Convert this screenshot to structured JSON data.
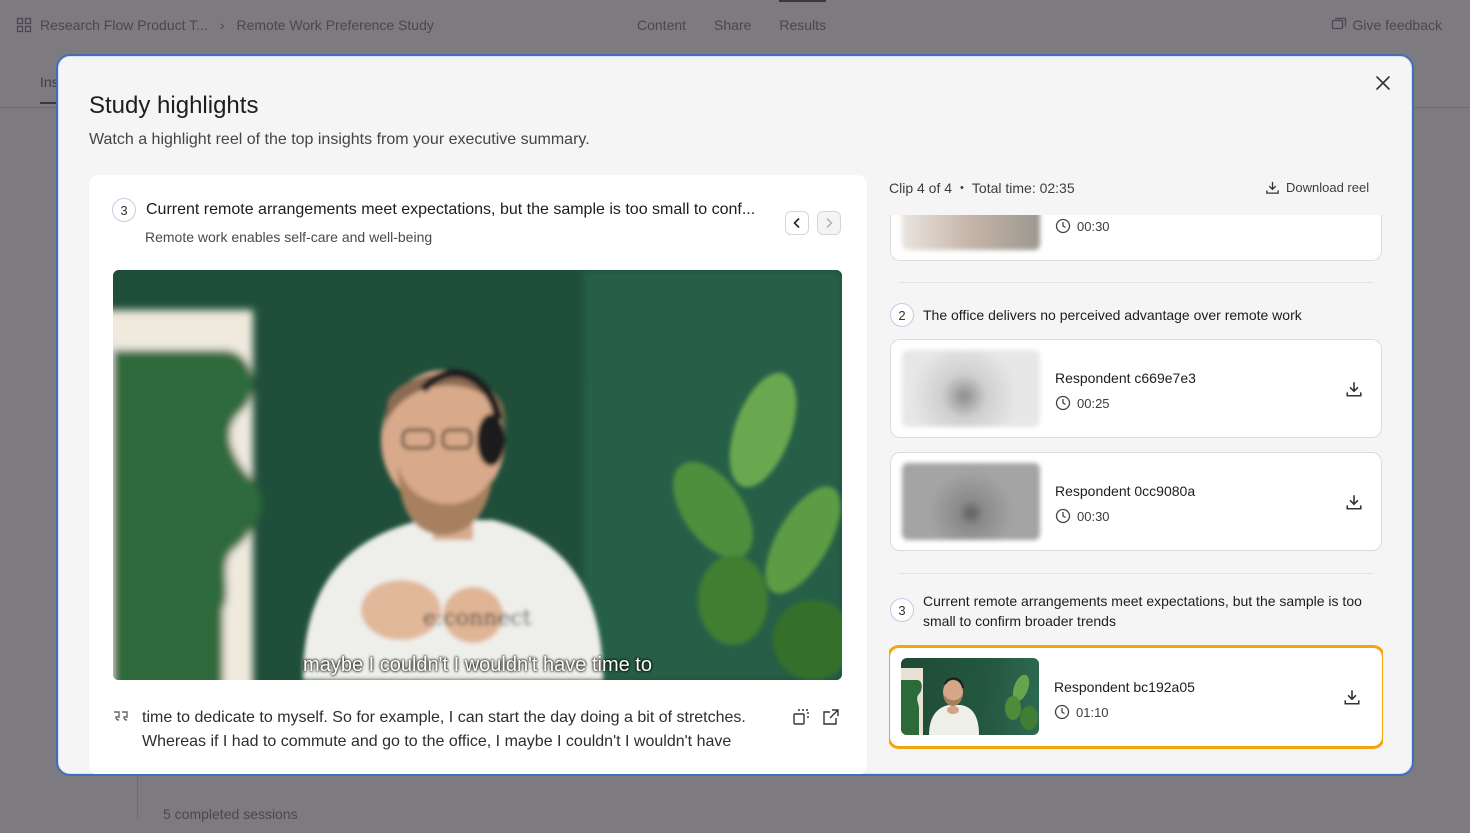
{
  "background": {
    "breadcrumb_project": "Research Flow Product T...",
    "breadcrumb_separator": "›",
    "breadcrumb_study": "Remote Work Preference Study",
    "tabs": [
      "Content",
      "Share",
      "Results"
    ],
    "feedback_label": "Give feedback",
    "sub_tab_label": "Ins",
    "bottom_text": "5 completed sessions"
  },
  "modal": {
    "title": "Study highlights",
    "subtitle": "Watch a highlight reel of the top insights from your executive summary.",
    "current": {
      "number": "3",
      "title": "Current remote arrangements meet expectations, but the sample is too small to conf...",
      "subtitle": "Remote work enables self-care and well-being",
      "caption": "maybe I couldn't I wouldn't have time to",
      "quote": "time to dedicate to myself. So for example, I can start the day doing a bit of stretches. Whereas if I had to commute and go to the office, I maybe I couldn't I wouldn't have"
    },
    "clip_info": {
      "clip_label": "Clip 4 of 4",
      "bullet": "•",
      "total_label": "Total time: 02:35"
    },
    "download_reel_label": "Download reel",
    "groups": [
      {
        "number": "",
        "title": "",
        "clips": [
          {
            "name": "",
            "duration": "00:30"
          }
        ]
      },
      {
        "number": "2",
        "title": "The office delivers no perceived advantage over remote work",
        "clips": [
          {
            "name": "Respondent c669e7e3",
            "duration": "00:25"
          },
          {
            "name": "Respondent 0cc9080a",
            "duration": "00:30"
          }
        ]
      },
      {
        "number": "3",
        "title": "Current remote arrangements meet expectations, but the sample is too small to confirm broader trends",
        "clips": [
          {
            "name": "Respondent bc192a05",
            "duration": "01:10",
            "active": true
          }
        ]
      }
    ]
  },
  "colors": {
    "active_outline": "#f2a50f",
    "modal_border": "#3f6fb8",
    "badge_border": "#cfc6e6"
  }
}
